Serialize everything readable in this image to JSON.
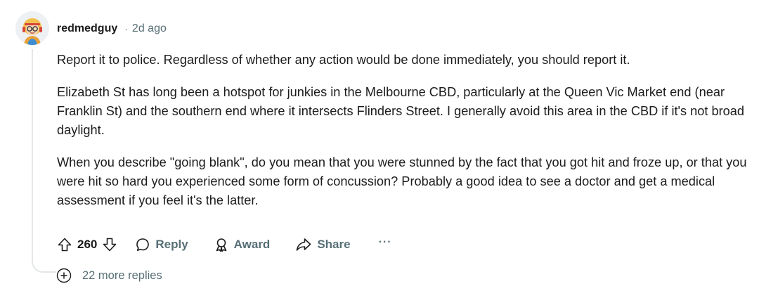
{
  "comment": {
    "author": "redmedguy",
    "separator": "·",
    "time": "2d ago",
    "paragraphs": [
      "Report it to police. Regardless of whether any action would be done immediately, you should report it.",
      "Elizabeth St has long been a hotspot for junkies in the Melbourne CBD, particularly at the Queen Vic Market end (near Franklin St) and the southern end where it intersects Flinders Street. I generally avoid this area in the CBD if it's not broad daylight.",
      "When you describe \"going blank\", do you mean that you were stunned by the fact that you got hit and froze up, or that you were hit so hard you experienced some form of concussion? Probably a good idea to see a doctor and get a medical assessment if you feel it's the latter."
    ]
  },
  "actions": {
    "upvote_icon": "arrow-up-icon",
    "score": "260",
    "downvote_icon": "arrow-down-icon",
    "reply_label": "Reply",
    "reply_icon": "speech-bubble-icon",
    "award_label": "Award",
    "award_icon": "award-ribbon-icon",
    "share_label": "Share",
    "share_icon": "share-arrow-icon",
    "more_label": "···"
  },
  "more_replies": {
    "label": "22 more replies",
    "icon": "plus-circle-icon"
  },
  "colors": {
    "text": "#1c1c1c",
    "muted": "#576f76",
    "thread_line": "#e4e7e9"
  }
}
